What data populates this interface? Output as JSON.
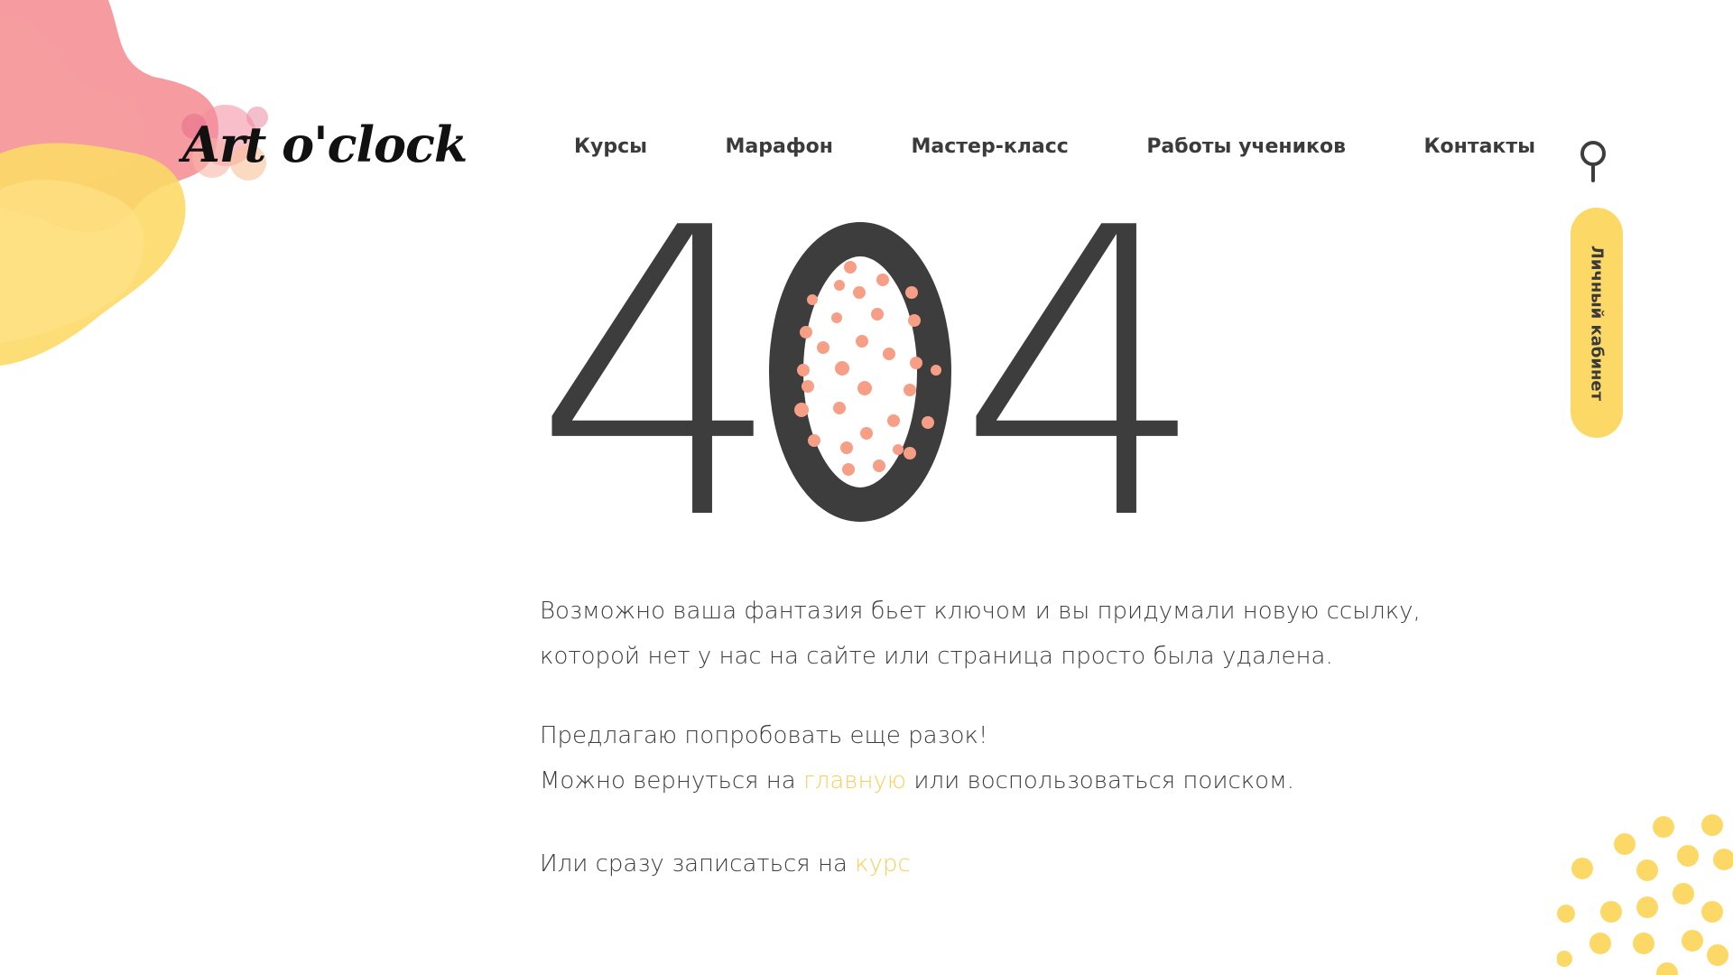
{
  "logo": {
    "text": "Art o'clock"
  },
  "nav": {
    "items": [
      {
        "label": "Курсы"
      },
      {
        "label": "Марафон"
      },
      {
        "label": "Мастер-класс"
      },
      {
        "label": "Работы учеников"
      },
      {
        "label": "Контакты"
      }
    ]
  },
  "cabinet": {
    "label": "Личный кабинет"
  },
  "error": {
    "code": "404"
  },
  "message": {
    "line1": "Возможно ваша фантазия бьет ключом и вы придумали новую ссылку,",
    "line2": "которой нет у нас на сайте или страница просто была удалена.",
    "line3": "Предлагаю попробовать еще разок!",
    "line4_before": "Можно вернуться на ",
    "line4_link": "главную",
    "line4_after": " или воспользоваться поиском.",
    "line5_before": "Или сразу записаться на ",
    "line5_link": "курс"
  },
  "colors": {
    "accent": "#f5cf5a",
    "button": "#fcd967",
    "digits": "#3d3d3d",
    "dots": "#f79f86",
    "blob_pink": "#f48a8e",
    "blob_yellow": "#fcd967"
  }
}
